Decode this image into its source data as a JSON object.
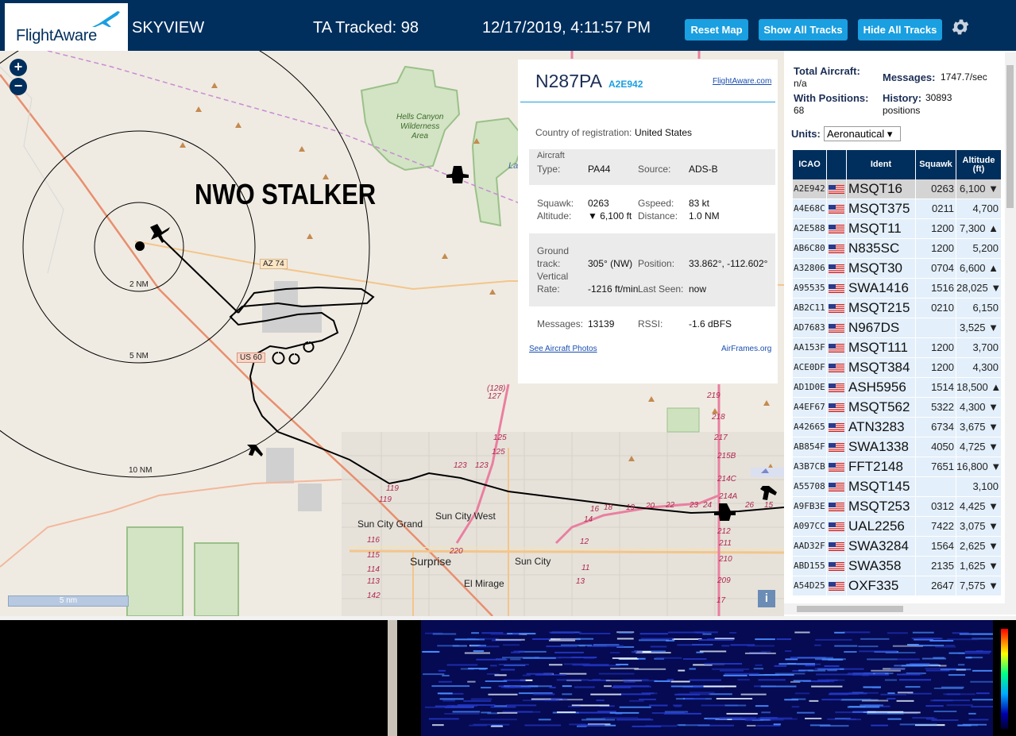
{
  "header": {
    "logo_text": "FlightAware",
    "app_name": "SKYVIEW",
    "tracked": "TA Tracked: 98",
    "datetime": "12/17/2019, 4:11:57 PM",
    "buttons": {
      "reset": "Reset Map",
      "show": "Show All Tracks",
      "hide": "Hide All Tracks"
    },
    "accent_color": "#1a9fe0",
    "bar_color": "#002f5d"
  },
  "map": {
    "zoom_in": "+",
    "zoom_out": "−",
    "overlay_text": "NWO STALKER",
    "range_rings": [
      "2 NM",
      "5 NM",
      "10 NM"
    ],
    "road_labels": [
      "AZ 74",
      "US 60"
    ],
    "area_labels": [
      "Hells Canyon",
      "Wilderness",
      "Area"
    ],
    "towns": [
      "Sun City Grand",
      "Sun City West",
      "Surprise",
      "Sun City",
      "El Mirage"
    ],
    "lake_label": "La",
    "route_numbers": [
      "(128)",
      "127",
      "125",
      "125",
      "123",
      "123",
      "119",
      "119",
      "116",
      "115",
      "114",
      "113",
      "142",
      "220",
      "219",
      "218",
      "217",
      "215B",
      "214C",
      "214A",
      "212",
      "211",
      "210",
      "209",
      "17",
      "16",
      "18",
      "19",
      "20",
      "22",
      "23",
      "24",
      "26",
      "15",
      "14",
      "12",
      "13",
      "11"
    ],
    "scale_label": "5 nm",
    "info_label": "i"
  },
  "popup": {
    "callsign": "N287PA",
    "hex": "A2E942",
    "link": "FlightAware.com",
    "country_label": "Country of registration:",
    "country": "United States",
    "aircraft_type_label": "Aircraft Type:",
    "aircraft_type_label_1": "Aircraft",
    "aircraft_type_label_2": "Type:",
    "aircraft_type": "PA44",
    "source_label": "Source:",
    "source": "ADS-B",
    "squawk_label": "Squawk:",
    "squawk": "0263",
    "gspeed_label": "Gspeed:",
    "gspeed": "83 kt",
    "altitude_label": "Altitude:",
    "altitude": "▼ 6,100 ft",
    "distance_label": "Distance:",
    "distance": "1.0 NM",
    "ground_track_label_1": "Ground",
    "ground_track_label_2": "track:",
    "ground_track": "305° (NW)",
    "position_label": "Position:",
    "position": "33.862°, -112.602°",
    "vrate_label_1": "Vertical",
    "vrate_label_2": "Rate:",
    "vrate": "-1216 ft/min",
    "last_seen_label": "Last Seen:",
    "last_seen": "now",
    "messages_label": "Messages:",
    "messages": "13139",
    "rssi_label": "RSSI:",
    "rssi": "-1.6 dBFS",
    "photos_link": "See Aircraft Photos",
    "airframes_link": "AirFrames.org"
  },
  "panel": {
    "total_label": "Total Aircraft:",
    "total_value": "n/a",
    "messages_label": "Messages:",
    "messages_value": "1747.7/sec",
    "positions_label": "With Positions:",
    "positions_value": "68",
    "history_label": "History:",
    "history_value": "30893",
    "history_unit": "positions",
    "units_label": "Units:",
    "units_value": "Aeronautical ▾",
    "columns": [
      "ICAO",
      "",
      "Ident",
      "Squawk",
      "Altitude (ft)"
    ],
    "rows": [
      {
        "icao": "A2E942",
        "ident": "MSQT16",
        "squawk": "0263",
        "alt": "6,100 ▼",
        "selected": true
      },
      {
        "icao": "A4E68C",
        "ident": "MSQT375",
        "squawk": "0211",
        "alt": "4,700"
      },
      {
        "icao": "A2E588",
        "ident": "MSQT11",
        "squawk": "1200",
        "alt": "7,300 ▲"
      },
      {
        "icao": "AB6C80",
        "ident": "N835SC",
        "squawk": "1200",
        "alt": "5,200"
      },
      {
        "icao": "A32806",
        "ident": "MSQT30",
        "squawk": "0704",
        "alt": "6,600 ▲"
      },
      {
        "icao": "A95535",
        "ident": "SWA1416",
        "squawk": "1516",
        "alt": "28,025 ▼"
      },
      {
        "icao": "AB2C11",
        "ident": "MSQT215",
        "squawk": "0210",
        "alt": "6,150"
      },
      {
        "icao": "AD7683",
        "ident": "N967DS",
        "squawk": "",
        "alt": "3,525 ▼"
      },
      {
        "icao": "AA153F",
        "ident": "MSQT111",
        "squawk": "1200",
        "alt": "3,700"
      },
      {
        "icao": "ACE0DF",
        "ident": "MSQT384",
        "squawk": "1200",
        "alt": "4,300"
      },
      {
        "icao": "AD1D0E",
        "ident": "ASH5956",
        "squawk": "1514",
        "alt": "18,500 ▲"
      },
      {
        "icao": "A4EF67",
        "ident": "MSQT562",
        "squawk": "5322",
        "alt": "4,300 ▼"
      },
      {
        "icao": "A42665",
        "ident": "ATN3283",
        "squawk": "6734",
        "alt": "3,675 ▼"
      },
      {
        "icao": "AB854F",
        "ident": "SWA1338",
        "squawk": "4050",
        "alt": "4,725 ▼"
      },
      {
        "icao": "A3B7CB",
        "ident": "FFT2148",
        "squawk": "7651",
        "alt": "16,800 ▼"
      },
      {
        "icao": "A55708",
        "ident": "MSQT145",
        "squawk": "",
        "alt": "3,100"
      },
      {
        "icao": "A9FB3E",
        "ident": "MSQT253",
        "squawk": "0312",
        "alt": "4,425 ▼"
      },
      {
        "icao": "A097CC",
        "ident": "UAL2256",
        "squawk": "7422",
        "alt": "3,075 ▼"
      },
      {
        "icao": "AAD32F",
        "ident": "SWA3284",
        "squawk": "1564",
        "alt": "2,625 ▼"
      },
      {
        "icao": "ABD155",
        "ident": "SWA358",
        "squawk": "2135",
        "alt": "1,625 ▼"
      },
      {
        "icao": "A54D25",
        "ident": "OXF335",
        "squawk": "2647",
        "alt": "7,575 ▼"
      }
    ]
  }
}
